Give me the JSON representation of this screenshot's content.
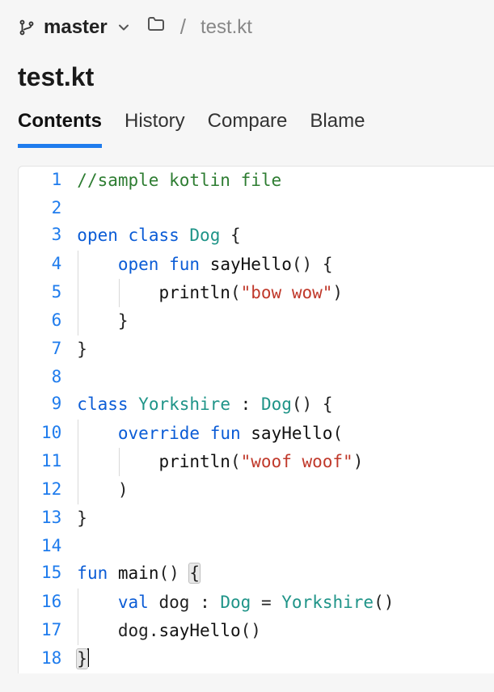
{
  "branch": {
    "name": "master"
  },
  "breadcrumb": {
    "filename": "test.kt"
  },
  "title": "test.kt",
  "tabs": [
    {
      "label": "Contents",
      "active": true
    },
    {
      "label": "History",
      "active": false
    },
    {
      "label": "Compare",
      "active": false
    },
    {
      "label": "Blame",
      "active": false
    }
  ],
  "code": {
    "language": "kotlin",
    "cursor_line": 18,
    "bracket_match_lines": [
      15,
      18
    ],
    "lines": [
      {
        "n": 1,
        "guides": [],
        "tokens": [
          [
            "cmt",
            "//sample kotlin file"
          ]
        ]
      },
      {
        "n": 2,
        "guides": [],
        "tokens": []
      },
      {
        "n": 3,
        "guides": [],
        "tokens": [
          [
            "kw",
            "open"
          ],
          [
            "sp",
            " "
          ],
          [
            "kw",
            "class"
          ],
          [
            "sp",
            " "
          ],
          [
            "type",
            "Dog"
          ],
          [
            "sp",
            " "
          ],
          [
            "pn",
            "{"
          ]
        ]
      },
      {
        "n": 4,
        "guides": [
          1
        ],
        "tokens": [
          [
            "sp",
            "    "
          ],
          [
            "kw",
            "open"
          ],
          [
            "sp",
            " "
          ],
          [
            "kw",
            "fun"
          ],
          [
            "sp",
            " "
          ],
          [
            "fn",
            "sayHello"
          ],
          [
            "pn",
            "()"
          ],
          [
            "sp",
            " "
          ],
          [
            "pn",
            "{"
          ]
        ]
      },
      {
        "n": 5,
        "guides": [
          1,
          2
        ],
        "tokens": [
          [
            "sp",
            "        "
          ],
          [
            "fn",
            "println"
          ],
          [
            "pn",
            "("
          ],
          [
            "str",
            "\"bow wow\""
          ],
          [
            "pn",
            ")"
          ]
        ]
      },
      {
        "n": 6,
        "guides": [
          1
        ],
        "tokens": [
          [
            "sp",
            "    "
          ],
          [
            "pn",
            "}"
          ]
        ]
      },
      {
        "n": 7,
        "guides": [],
        "tokens": [
          [
            "pn",
            "}"
          ]
        ]
      },
      {
        "n": 8,
        "guides": [],
        "tokens": []
      },
      {
        "n": 9,
        "guides": [],
        "tokens": [
          [
            "kw",
            "class"
          ],
          [
            "sp",
            " "
          ],
          [
            "type",
            "Yorkshire"
          ],
          [
            "sp",
            " "
          ],
          [
            "pn",
            ":"
          ],
          [
            "sp",
            " "
          ],
          [
            "type",
            "Dog"
          ],
          [
            "pn",
            "()"
          ],
          [
            "sp",
            " "
          ],
          [
            "pn",
            "{"
          ]
        ]
      },
      {
        "n": 10,
        "guides": [
          1
        ],
        "tokens": [
          [
            "sp",
            "    "
          ],
          [
            "kw",
            "override"
          ],
          [
            "sp",
            " "
          ],
          [
            "kw",
            "fun"
          ],
          [
            "sp",
            " "
          ],
          [
            "fn",
            "sayHello"
          ],
          [
            "pn",
            "("
          ]
        ]
      },
      {
        "n": 11,
        "guides": [
          1,
          2
        ],
        "tokens": [
          [
            "sp",
            "        "
          ],
          [
            "fn",
            "println"
          ],
          [
            "pn",
            "("
          ],
          [
            "str",
            "\"woof woof\""
          ],
          [
            "pn",
            ")"
          ]
        ]
      },
      {
        "n": 12,
        "guides": [
          1
        ],
        "tokens": [
          [
            "sp",
            "    "
          ],
          [
            "pn",
            ")"
          ]
        ]
      },
      {
        "n": 13,
        "guides": [],
        "tokens": [
          [
            "pn",
            "}"
          ]
        ]
      },
      {
        "n": 14,
        "guides": [],
        "tokens": []
      },
      {
        "n": 15,
        "guides": [],
        "tokens": [
          [
            "kw",
            "fun"
          ],
          [
            "sp",
            " "
          ],
          [
            "fn",
            "main"
          ],
          [
            "pn",
            "()"
          ],
          [
            "sp",
            " "
          ],
          [
            "brmatch",
            "{"
          ]
        ]
      },
      {
        "n": 16,
        "guides": [
          1
        ],
        "tokens": [
          [
            "sp",
            "    "
          ],
          [
            "kw",
            "val"
          ],
          [
            "sp",
            " "
          ],
          [
            "pn",
            "dog"
          ],
          [
            "sp",
            " "
          ],
          [
            "pn",
            ":"
          ],
          [
            "sp",
            " "
          ],
          [
            "type",
            "Dog"
          ],
          [
            "sp",
            " "
          ],
          [
            "pn",
            "="
          ],
          [
            "sp",
            " "
          ],
          [
            "type",
            "Yorkshire"
          ],
          [
            "pn",
            "()"
          ]
        ]
      },
      {
        "n": 17,
        "guides": [
          1
        ],
        "tokens": [
          [
            "sp",
            "    "
          ],
          [
            "pn",
            "dog"
          ],
          [
            "pn",
            "."
          ],
          [
            "fn",
            "sayHello"
          ],
          [
            "pn",
            "()"
          ]
        ]
      },
      {
        "n": 18,
        "guides": [],
        "tokens": [
          [
            "brmatch",
            "}"
          ],
          [
            "cursor",
            ""
          ]
        ]
      }
    ]
  }
}
